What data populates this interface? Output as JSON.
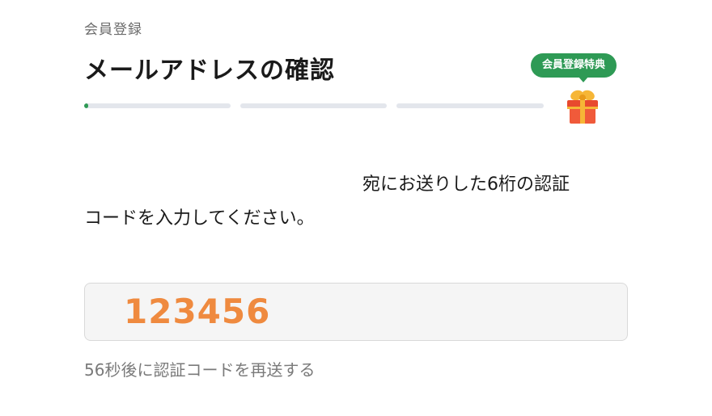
{
  "breadcrumb": "会員登録",
  "title": "メールアドレスの確認",
  "progress": {
    "steps": 3,
    "current_step_fill": 0.01
  },
  "gift": {
    "badge_label": "会員登録特典",
    "icon": "gift-icon"
  },
  "description": {
    "line1": "宛にお送りした6桁の認証",
    "line2": "コードを入力してください。"
  },
  "code_input": {
    "value": "123456"
  },
  "resend": {
    "text": "56秒後に認証コードを再送する"
  },
  "colors": {
    "accent": "#2e9a55",
    "code_text": "#ef8a3f",
    "progress_track": "#e3e6ec",
    "field_bg": "#f5f5f5"
  }
}
